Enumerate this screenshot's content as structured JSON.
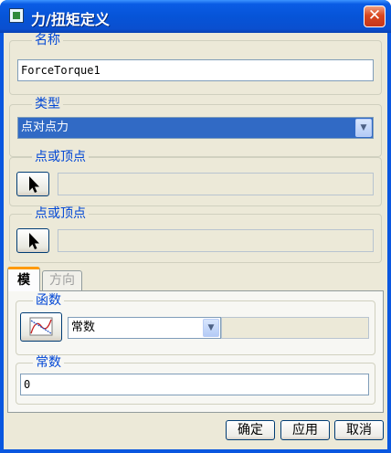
{
  "window": {
    "title": "力/扭矩定义",
    "close_symbol": "✕"
  },
  "name_group": {
    "label": "名称",
    "value": "ForceTorque1"
  },
  "type_group": {
    "label": "类型",
    "selected": "点对点力"
  },
  "point1_group": {
    "label": "点或顶点",
    "value": ""
  },
  "point2_group": {
    "label": "点或顶点",
    "value": ""
  },
  "tabs": [
    {
      "label": "模"
    },
    {
      "label": "方向"
    }
  ],
  "function_group": {
    "label": "函数",
    "selected": "常数",
    "extra_value": ""
  },
  "constant_group": {
    "label": "常数",
    "value": "0"
  },
  "buttons": {
    "ok": "确定",
    "apply": "应用",
    "cancel": "取消"
  },
  "icons": [
    "window-icon",
    "close-icon",
    "arrow-cursor-icon",
    "combo-arrow-icon",
    "function-graph-icon"
  ]
}
